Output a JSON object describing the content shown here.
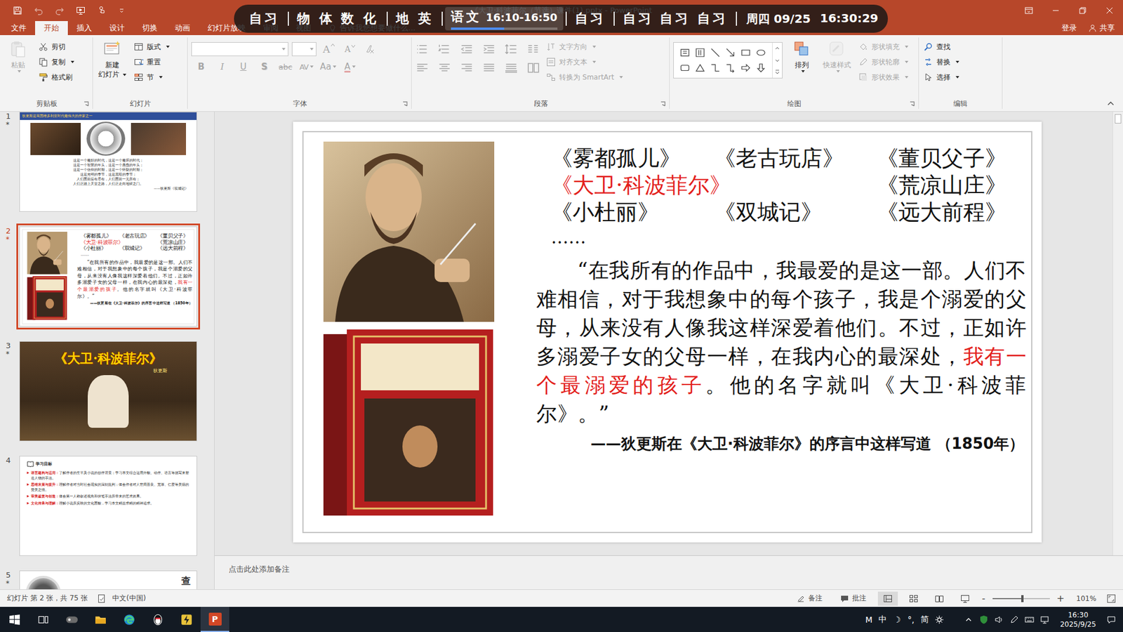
{
  "window": {
    "title": "《大卫·科波菲尔（节选）课件(1).pptx - PowerPoint"
  },
  "schedule": {
    "periods": [
      {
        "text": "自习",
        "time": "",
        "selected": false,
        "level": 0
      },
      {
        "text": "物 体 数 化",
        "time": "",
        "selected": false,
        "level": 0
      },
      {
        "text": "地 英",
        "time": "",
        "selected": false,
        "level": 0
      },
      {
        "text": "语文",
        "time": "16:10-16:50",
        "selected": true,
        "level": 0.5
      },
      {
        "text": "自习",
        "time": "",
        "selected": false,
        "level": 0
      },
      {
        "text": "自习 自习 自习",
        "time": "",
        "selected": false,
        "level": 0
      }
    ],
    "date": "周四 09/25",
    "clock": "16:30:29"
  },
  "tabs": [
    {
      "label": "文件",
      "selected": false
    },
    {
      "label": "开始",
      "selected": true
    },
    {
      "label": "插入",
      "selected": false
    },
    {
      "label": "设计",
      "selected": false
    },
    {
      "label": "切换",
      "selected": false
    },
    {
      "label": "动画",
      "selected": false
    },
    {
      "label": "幻灯片放映",
      "selected": false
    },
    {
      "label": "审阅",
      "selected": false
    },
    {
      "label": "视图",
      "selected": false
    }
  ],
  "tell_me": "告诉我您想要做什么...",
  "account": {
    "sign_in": "登录",
    "share": "共享"
  },
  "ribbon": {
    "clipboard": {
      "label": "剪贴板",
      "paste": {
        "label": "粘贴",
        "disabled": true
      },
      "items": [
        {
          "label": "剪切",
          "kind": "cut",
          "disabled": false,
          "dropdown": false
        },
        {
          "label": "复制",
          "kind": "copy",
          "disabled": false,
          "dropdown": true
        },
        {
          "label": "格式刷",
          "kind": "painter",
          "disabled": false,
          "dropdown": false
        }
      ]
    },
    "slides": {
      "label": "幻灯片",
      "new_slide": [
        "新建",
        "幻灯片"
      ],
      "items": [
        {
          "label": "版式",
          "kind": "layout",
          "dropdown": true
        },
        {
          "label": "重置",
          "kind": "reset",
          "dropdown": false
        },
        {
          "label": "节",
          "kind": "section",
          "dropdown": true
        }
      ]
    },
    "font": {
      "label": "字体",
      "disabled": true,
      "grow": "A",
      "shrink": "A",
      "styles": [
        {
          "text": "B",
          "kind": "bold"
        },
        {
          "text": "I",
          "kind": "italic"
        },
        {
          "text": "U",
          "kind": "underline"
        },
        {
          "text": "S",
          "kind": "shadow"
        },
        {
          "text": "abc",
          "kind": "strike"
        },
        {
          "text": "AV",
          "kind": "spacing"
        },
        {
          "text": "Aa",
          "kind": "case"
        },
        {
          "text": "A",
          "kind": "color"
        }
      ]
    },
    "paragraph": {
      "label": "段落",
      "disabled": true,
      "items": [
        {
          "label": "文字方向",
          "kind": "direction"
        },
        {
          "label": "对齐文本",
          "kind": "align"
        },
        {
          "label": "转换为 SmartArt",
          "kind": "smartart"
        }
      ]
    },
    "drawing": {
      "label": "绘图",
      "arrange": {
        "label": "排列",
        "disabled": false
      },
      "quick_styles": {
        "label": "快速样式",
        "disabled": true
      },
      "items": [
        {
          "label": "形状填充",
          "kind": "fill",
          "disabled": true
        },
        {
          "label": "形状轮廓",
          "kind": "outline",
          "disabled": true
        },
        {
          "label": "形状效果",
          "kind": "effects",
          "disabled": true
        }
      ]
    },
    "editing": {
      "label": "编辑",
      "items": [
        {
          "label": "查找",
          "kind": "find",
          "dropdown": false
        },
        {
          "label": "替换",
          "kind": "replace",
          "dropdown": true
        },
        {
          "label": "选择",
          "kind": "select",
          "dropdown": true
        }
      ]
    }
  },
  "animation_mark": "*",
  "thumbnails": [
    {
      "number": "1",
      "selected": false,
      "animated": true,
      "kind": "poem",
      "banner": "狄更斯是英国维多利亚时代最伟大的作家之一",
      "lines": [
        "这是一个最好的时代，这是一个最坏的时代；",
        "这是一个智慧的年头，这是一个愚蠢的年头；",
        "这是一个信仰的时期，这是一个怀疑的时期；",
        "这是光明的季节，这是黑暗的季节；",
        "人们面前应有尽有，人们面前一无所有；",
        "人们正踏上天堂之路，人们正走向地狱之门。"
      ],
      "source": "——狄更斯《双城记》"
    },
    {
      "number": "2",
      "selected": true,
      "animated": true,
      "kind": "works"
    },
    {
      "number": "3",
      "selected": false,
      "animated": true,
      "kind": "title",
      "title": "《大卫·科波菲尔》",
      "subtitle": "狄更斯"
    },
    {
      "number": "4",
      "selected": false,
      "animated": false,
      "kind": "goals",
      "heading": "学习目标",
      "goals": [
        {
          "label": "语言建构与运用：",
          "text": "了解作者的生平及小说的创作背景；学习本文综合运用外貌、动作、语言等描写来塑造人物的手法。"
        },
        {
          "label": "思维发展与提升：",
          "text": "理解作者对当时社会现实的深刻批判；体会作者对人世间善良、宽厚、仁爱等美德的赞美之情。"
        },
        {
          "label": "审美鉴赏与创造：",
          "text": "体会第一人称叙述视角和伏笔手法所带来的艺术效果。"
        },
        {
          "label": "文化传承与理解：",
          "text": "理解小说所反映的文化面貌，学习本文精益求精的精神追求。"
        }
      ]
    },
    {
      "number": "5",
      "selected": false,
      "animated": true,
      "kind": "portrait",
      "caption": "查"
    }
  ],
  "slide": {
    "works": [
      {
        "title": "《雾都孤儿》",
        "highlight": false
      },
      {
        "title": "《老古玩店》",
        "highlight": false
      },
      {
        "title": "《董贝父子》",
        "highlight": false
      },
      {
        "title": "《大卫·科波菲尔》",
        "highlight": true
      },
      {
        "title": "《荒凉山庄》",
        "highlight": false
      },
      {
        "title": "《小杜丽》",
        "highlight": false
      },
      {
        "title": "《双城记》",
        "highlight": false
      },
      {
        "title": "《远大前程》",
        "highlight": false
      }
    ],
    "ellipsis": "……",
    "quote": [
      {
        "text": "“在我所有的作品中，我最爱的是这一部。人们不难相信，对于我想象中的每个孩子，我是个溺爱的父母，从来没有人像我这样深爱着他们。不过，正如许多溺爱子女的父母一样，在我内心的最深处，",
        "highlight": false
      },
      {
        "text": "我有一个最溺爱的孩子",
        "highlight": true
      },
      {
        "text": "。他的名字就叫《大卫·科波菲尔》。”",
        "highlight": false
      }
    ],
    "attribution": "——狄更斯在《大卫·科波菲尔》的序言中这样写道 （1850年）"
  },
  "notes_placeholder": "点击此处添加备注",
  "status_bar": {
    "slide_info": "幻灯片 第 2 张，共 75 张",
    "language": "中文(中国)",
    "notes": "备注",
    "comments": "批注",
    "views": [
      {
        "kind": "normal",
        "selected": true
      },
      {
        "kind": "sorter",
        "selected": false
      },
      {
        "kind": "reading",
        "selected": false
      },
      {
        "kind": "show",
        "selected": false
      }
    ],
    "zoom_out": "-",
    "zoom_in": "+",
    "zoom": "101%",
    "zoom_level": 0.5
  },
  "taskbar": {
    "apps": [
      {
        "kind": "taskview",
        "badge": "",
        "active": false
      },
      {
        "kind": "tool",
        "badge": "",
        "active": false
      },
      {
        "kind": "explorer",
        "badge": "",
        "active": false
      },
      {
        "kind": "edge",
        "badge": "",
        "active": false
      },
      {
        "kind": "qq",
        "badge": "",
        "active": false
      },
      {
        "kind": "app",
        "badge": "",
        "active": false
      },
      {
        "kind": "powerpoint",
        "badge": "P",
        "active": true
      }
    ],
    "ime": [
      "M",
      "中",
      "☽",
      "°,",
      "简"
    ],
    "time": "16:30",
    "date": "2025/9/25"
  }
}
